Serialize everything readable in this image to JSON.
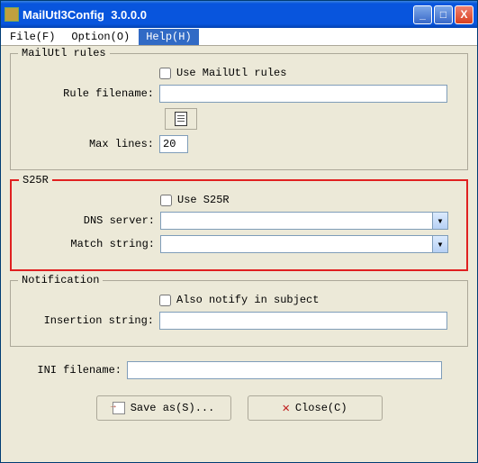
{
  "title": "MailUtl3Config  3.0.0.0",
  "menu": {
    "file": "File(F)",
    "option": "Option(O)",
    "help": "Help(H)"
  },
  "group_mailutl": {
    "legend": "MailUtl rules",
    "use_rules_label": "Use MailUtl rules",
    "use_rules_checked": false,
    "rule_filename_label": "Rule filename:",
    "rule_filename_value": "",
    "max_lines_label": "Max lines:",
    "max_lines_value": "20"
  },
  "group_s25r": {
    "legend": "S25R",
    "use_s25r_label": "Use S25R",
    "use_s25r_checked": false,
    "dns_label": "DNS server:",
    "dns_value": "",
    "match_label": "Match string:",
    "match_value": ""
  },
  "group_notification": {
    "legend": "Notification",
    "also_notify_label": "Also notify in subject",
    "also_notify_checked": false,
    "insertion_label": "Insertion string:",
    "insertion_value": ""
  },
  "ini_filename_label": "INI filename:",
  "ini_filename_value": "",
  "buttons": {
    "save_as": "Save as(S)...",
    "close": "Close(C)"
  },
  "icons": {
    "minimize": "_",
    "maximize": "□",
    "close": "X",
    "dropdown": "▾"
  }
}
